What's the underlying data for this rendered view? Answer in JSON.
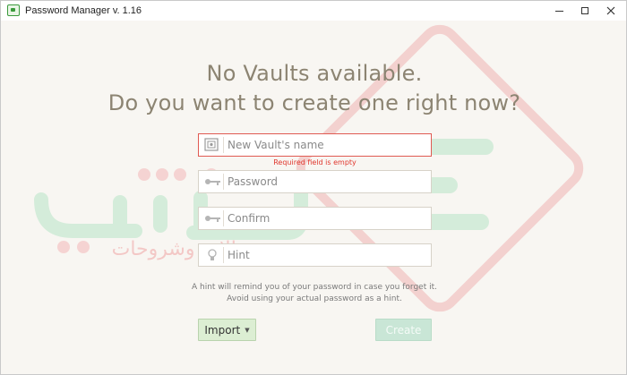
{
  "window": {
    "title": "Password Manager v. 1.16",
    "minimize_icon": "minimize-icon",
    "maximize_icon": "maximize-icon",
    "close_icon": "close-icon"
  },
  "main": {
    "headline_line1": "No Vaults available.",
    "headline_line2": "Do you want to create one right now?"
  },
  "form": {
    "vault_name": {
      "placeholder": "New Vault's name",
      "value": "",
      "icon": "vault-icon"
    },
    "vault_name_error": "Required field is empty",
    "password": {
      "placeholder": "Password",
      "value": "",
      "icon": "key-icon"
    },
    "confirm": {
      "placeholder": "Confirm",
      "value": "",
      "icon": "key-icon"
    },
    "hint": {
      "placeholder": "Hint",
      "value": "",
      "icon": "lightbulb-icon"
    },
    "hint_note_line1": "A hint will remind you of your password in case you forget it.",
    "hint_note_line2": "Avoid using your actual password as a hint."
  },
  "actions": {
    "import_label": "Import",
    "create_label": "Create"
  },
  "watermark": {
    "text": "مقالات وشروحات"
  },
  "colors": {
    "background": "#f8f6f2",
    "headline": "#8c8472",
    "error": "#e0372e",
    "error_border": "#e05a52",
    "import_bg": "#dceed3",
    "create_bg": "#c9e6d6",
    "watermark_green": "#9ed9b2",
    "watermark_red": "#f3b3b3"
  }
}
